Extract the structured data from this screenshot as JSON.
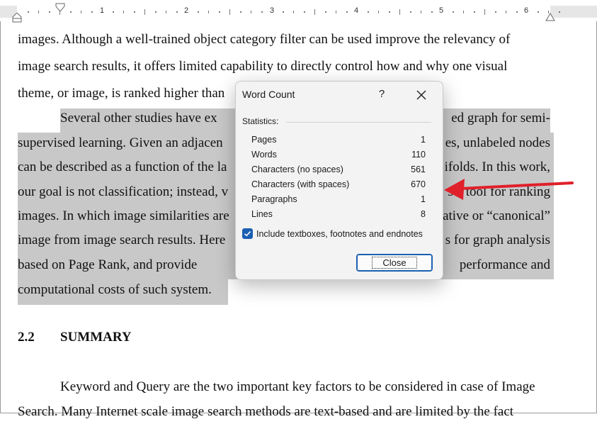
{
  "ruler": {
    "numbers": [
      "1",
      "2",
      "3",
      "4",
      "5",
      "6"
    ]
  },
  "document": {
    "lines_top": [
      "images. Although a well-trained object category filter can be used improve the relevancy of",
      "image search results, it offers limited capability to directly control how and why one visual",
      "theme, or image, is ranked higher than"
    ],
    "highlighted_left": [
      "Several other studies have ex",
      "supervised learning. Given an adjacen",
      "can be described as a function of the la",
      "our goal is not classification; instead, v",
      "images. In which image similarities are",
      "image from image search results. Here",
      "based on Page Rank, and provide",
      "computational costs of such system."
    ],
    "highlighted_right": [
      "ed graph for semi-",
      "es, unlabeled nodes",
      "ifolds. In this work,",
      "s a tool for ranking",
      "ative or “canonical”",
      "s for graph analysis",
      "performance and",
      ""
    ],
    "section_number": "2.2",
    "section_title": "SUMMARY",
    "body_lines": [
      "Keyword and Query are the two important key factors to be considered in case of Image",
      "Search. Many Internet scale image search methods are text-based and are limited by the fact"
    ]
  },
  "dialog": {
    "title": "Word Count",
    "help": "?",
    "statistics_label": "Statistics:",
    "stats": [
      {
        "name": "Pages",
        "value": "1"
      },
      {
        "name": "Words",
        "value": "110"
      },
      {
        "name": "Characters (no spaces)",
        "value": "561"
      },
      {
        "name": "Characters (with spaces)",
        "value": "670"
      },
      {
        "name": "Paragraphs",
        "value": "1"
      },
      {
        "name": "Lines",
        "value": "8"
      }
    ],
    "checkbox_label": "Include textboxes, footnotes and endnotes",
    "checkbox_checked": true,
    "close_label": "Close"
  },
  "colors": {
    "highlight": "#c8c8c8",
    "accent": "#1b5fb3",
    "arrow": "#e0202a"
  }
}
